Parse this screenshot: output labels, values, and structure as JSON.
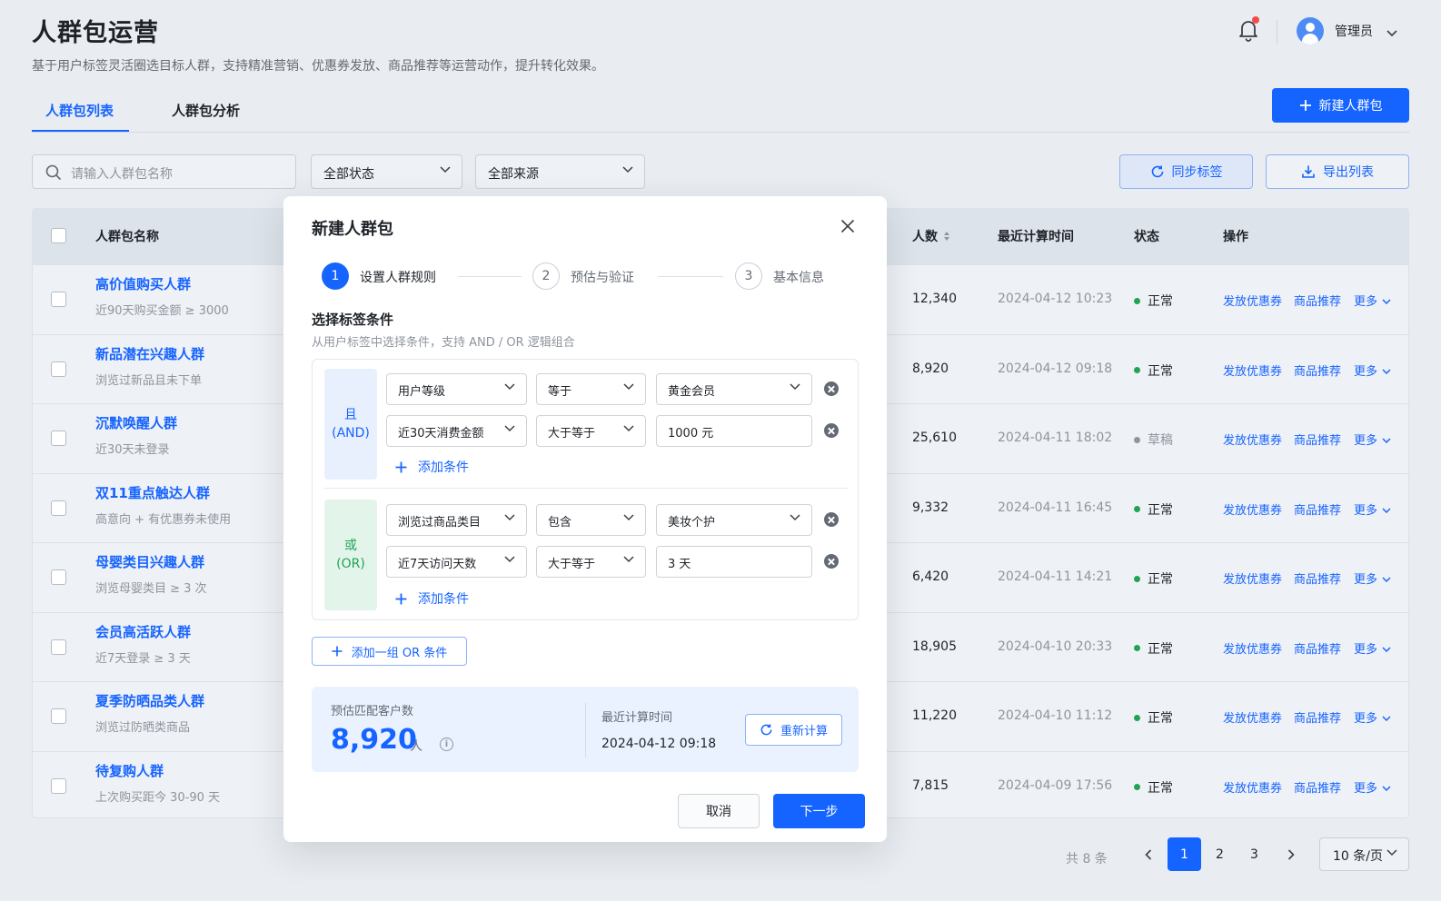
{
  "header": {
    "title": "人群包运营",
    "subtitle": "基于用户标签灵活圈选目标人群，支持精准营销、优惠券发放、商品推荐等运营动作，提升转化效果。",
    "user_name": "管理员"
  },
  "tabs": [
    {
      "label": "人群包列表",
      "active": true
    },
    {
      "label": "人群包分析",
      "active": false
    }
  ],
  "new_button_label": "新建人群包",
  "filters": {
    "search_placeholder": "请输入人群包名称",
    "status_select": "全部状态",
    "source_select": "全部来源",
    "sync_label": "同步标签",
    "export_label": "导出列表"
  },
  "table": {
    "headers": {
      "name": "人群包名称",
      "count": "人数",
      "time": "最近计算时间",
      "status": "状态",
      "actions": "操作"
    },
    "rows": [
      {
        "name": "高价值购买人群",
        "desc": "近90天购买金额 ≥ 3000",
        "count": "12,340",
        "time": "2024-04-12 10:23",
        "status": "正常"
      },
      {
        "name": "新品潜在兴趣人群",
        "desc": "浏览过新品且未下单",
        "count": "8,920",
        "time": "2024-04-12 09:18",
        "status": "正常"
      },
      {
        "name": "沉默唤醒人群",
        "desc": "近30天未登录",
        "count": "25,610",
        "time": "2024-04-11 18:02",
        "status": "草稿"
      },
      {
        "name": "双11重点触达人群",
        "desc": "高意向 + 有优惠券未使用",
        "count": "9,332",
        "time": "2024-04-11 16:45",
        "status": "正常"
      },
      {
        "name": "母婴类目兴趣人群",
        "desc": "浏览母婴类目 ≥ 3 次",
        "count": "6,420",
        "time": "2024-04-11 14:21",
        "status": "正常"
      },
      {
        "name": "会员高活跃人群",
        "desc": "近7天登录 ≥ 3 天",
        "count": "18,905",
        "time": "2024-04-10 20:33",
        "status": "正常"
      },
      {
        "name": "夏季防晒品类人群",
        "desc": "浏览过防晒类商品",
        "count": "11,220",
        "time": "2024-04-10 11:12",
        "status": "正常"
      },
      {
        "name": "待复购人群",
        "desc": "上次购买距今 30-90 天",
        "count": "7,815",
        "time": "2024-04-09 17:56",
        "status": "正常"
      }
    ],
    "actions": {
      "coupon": "发放优惠券",
      "recommend": "商品推荐",
      "more": "更多"
    },
    "status_colors": {
      "正常": "#21a357",
      "草稿": "#8f959e"
    }
  },
  "pagination": {
    "total": "共 8 条",
    "pages": [
      "1",
      "2",
      "3"
    ],
    "current": "1",
    "page_size": "10 条/页"
  },
  "modal": {
    "title": "新建人群包",
    "steps": [
      {
        "num": "1",
        "label": "设置人群规则",
        "active": true
      },
      {
        "num": "2",
        "label": "预估与验证",
        "active": false
      },
      {
        "num": "3",
        "label": "基本信息",
        "active": false
      }
    ],
    "section_title": "选择标签条件",
    "section_subtitle": "从用户标签中选择条件，支持 AND / OR 逻辑组合",
    "groups": [
      {
        "tag_line1": "且",
        "tag_line2": "(AND)",
        "conditions": [
          {
            "field": "用户等级",
            "op": "等于",
            "value": "黄金会员",
            "value_is_select": true
          },
          {
            "field": "近30天消费金额",
            "op": "大于等于",
            "value": "1000 元",
            "value_is_select": false
          }
        ],
        "add_label": "添加条件"
      },
      {
        "tag_line1": "或",
        "tag_line2": "(OR)",
        "conditions": [
          {
            "field": "浏览过商品类目",
            "op": "包含",
            "value": "美妆个护",
            "value_is_select": true
          },
          {
            "field": "近7天访问天数",
            "op": "大于等于",
            "value": "3 天",
            "value_is_select": false
          }
        ],
        "add_label": "添加条件"
      }
    ],
    "add_or_group_label": "添加一组 OR 条件",
    "estimate": {
      "label": "预估匹配客户数",
      "value": "8,920",
      "unit": "人",
      "info_icon": "i",
      "time_label": "最近计算时间",
      "time_value": "2024-04-12 09:18",
      "recalc_label": "重新计算"
    },
    "cancel_label": "取消",
    "next_label": "下一步"
  },
  "colors": {
    "primary": "#1664ff",
    "success": "#21a357",
    "danger": "#f54a45",
    "page_bg": "#e9edf2"
  }
}
